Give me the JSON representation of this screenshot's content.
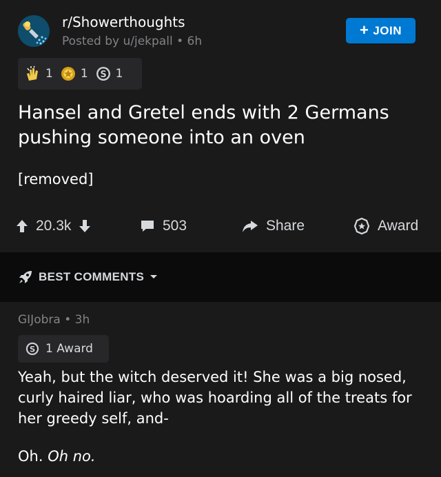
{
  "post": {
    "subreddit": "r/Showerthoughts",
    "posted_by": "Posted by u/jekpall",
    "separator": "•",
    "age": "6h",
    "join_label": "JOIN",
    "awards": [
      {
        "icon": "clapping-hands-icon",
        "count": "1"
      },
      {
        "icon": "gold-award-icon",
        "count": "1"
      },
      {
        "icon": "silver-award-icon",
        "count": "1"
      }
    ],
    "title": "Hansel and Gretel ends with 2 Germans pushing someone into an oven",
    "body": "[removed]",
    "votes": "20.3k",
    "comments_count": "503",
    "share_label": "Share",
    "award_label": "Award"
  },
  "sort": {
    "label": "BEST COMMENTS"
  },
  "comment": {
    "author": "GIJobra",
    "separator": "•",
    "age": "3h",
    "award_text": "1 Award",
    "text": "Yeah, but the witch deserved it! She was a big nosed, curly haired liar, who was hoarding all of the treats for her greedy self, and-",
    "reply_plain": "Oh. ",
    "reply_italic": "Oh no."
  },
  "colors": {
    "background": "#1a1a1b",
    "accent": "#0079d3",
    "muted": "#818384",
    "panel": "#272729"
  }
}
